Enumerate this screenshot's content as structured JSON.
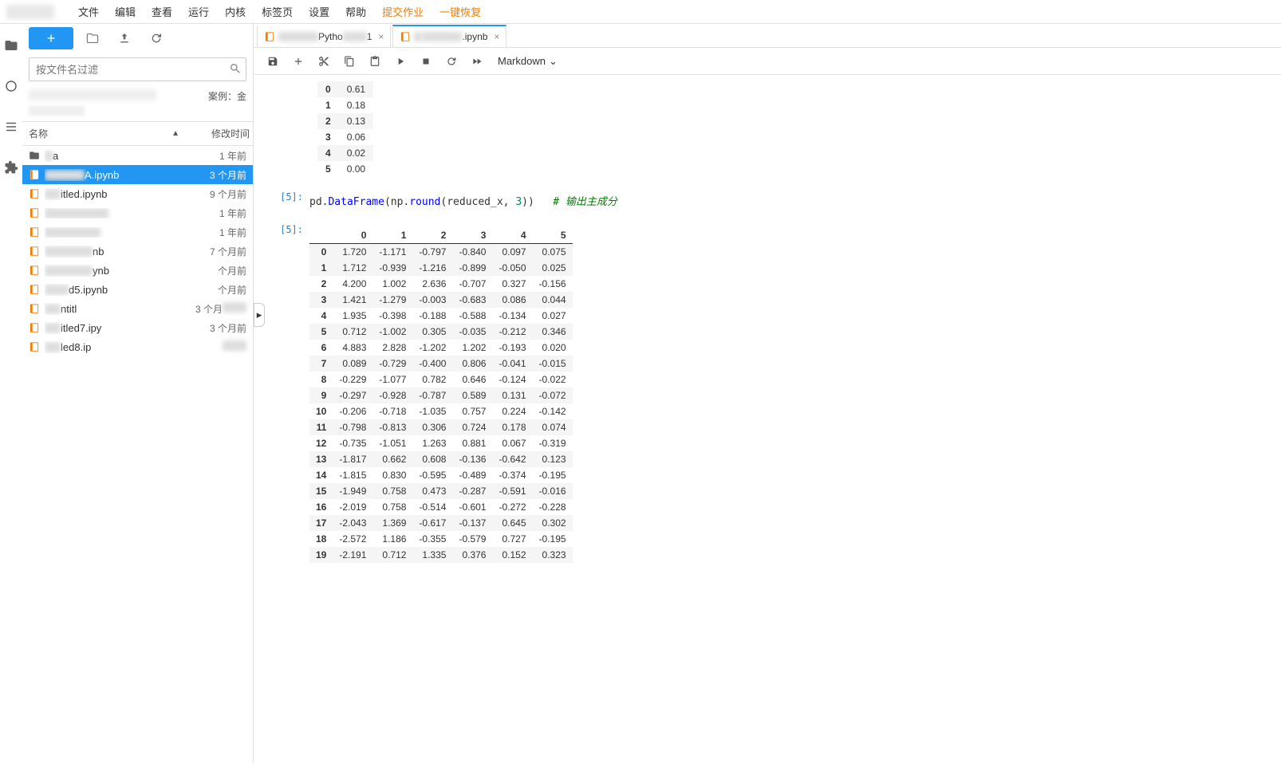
{
  "menu": [
    "文件",
    "编辑",
    "查看",
    "运行",
    "内核",
    "标签页",
    "设置",
    "帮助"
  ],
  "menu_extra": [
    "提交作业",
    "一键恢复"
  ],
  "sidebar": {
    "search_placeholder": "按文件名过滤",
    "crumb_right": "案例：金",
    "header_name": "名称",
    "header_mod": "修改时间",
    "files": [
      {
        "type": "folder",
        "name_visible": "a",
        "blur_w": 10,
        "mod": "1 年前",
        "selected": false
      },
      {
        "type": "nb",
        "name_visible": "A.ipynb",
        "blur_w": 50,
        "mod": "3 个月前",
        "selected": true
      },
      {
        "type": "nb",
        "name_visible": "itled.ipynb",
        "blur_w": 20,
        "mod": "9 个月前",
        "selected": false
      },
      {
        "type": "nb",
        "name_visible": "",
        "blur_w": 80,
        "mod": "1 年前",
        "selected": false
      },
      {
        "type": "nb",
        "name_visible": "",
        "blur_w": 70,
        "mod": "1 年前",
        "selected": false
      },
      {
        "type": "nb",
        "name_visible": "nb",
        "blur_w": 60,
        "mod": "7 个月前",
        "selected": false
      },
      {
        "type": "nb",
        "name_visible": "ynb",
        "blur_w": 60,
        "mod": "个月前",
        "selected": false
      },
      {
        "type": "nb",
        "name_visible": "d5.ipynb",
        "blur_w": 30,
        "mod": "个月前",
        "selected": false
      },
      {
        "type": "nb",
        "name_visible": "ntitl",
        "blur_w": 20,
        "mod": "3 个月",
        "selected": false,
        "mod_blur": true
      },
      {
        "type": "nb",
        "name_visible": "itled7.ipy",
        "blur_w": 20,
        "mod": "3 个月前",
        "selected": false
      },
      {
        "type": "nb",
        "name_visible": "led8.ip",
        "blur_w": 20,
        "mod": "",
        "selected": false,
        "mod_blur": true
      }
    ]
  },
  "tabs": [
    {
      "label_pre": "",
      "label_vis": "Pytho",
      "label_suf": "1",
      "blur1": 50,
      "blur2": 30,
      "active": false
    },
    {
      "label_pre": "p",
      "label_vis": "",
      "label_suf": ".ipynb",
      "blur1": 10,
      "blur2": 50,
      "active": true
    }
  ],
  "nb_toolbar": {
    "celltype": "Markdown"
  },
  "small_table": {
    "rows": [
      [
        "0",
        "0.61"
      ],
      [
        "1",
        "0.18"
      ],
      [
        "2",
        "0.13"
      ],
      [
        "3",
        "0.06"
      ],
      [
        "4",
        "0.02"
      ],
      [
        "5",
        "0.00"
      ]
    ]
  },
  "code_cell": {
    "prompt": "[5]:",
    "out_prompt": "[5]:",
    "code_prefix": "pd.",
    "code_fn": "DataFrame",
    "code_mid": "(np.",
    "code_fn2": "round",
    "code_args": "(reduced_x, ",
    "code_num": "3",
    "code_end": "))",
    "code_comment": "# 输出主成分"
  },
  "chart_data": {
    "type": "table",
    "columns": [
      "0",
      "1",
      "2",
      "3",
      "4",
      "5"
    ],
    "index": [
      "0",
      "1",
      "2",
      "3",
      "4",
      "5",
      "6",
      "7",
      "8",
      "9",
      "10",
      "11",
      "12",
      "13",
      "14",
      "15",
      "16",
      "17",
      "18",
      "19"
    ],
    "data": [
      [
        "1.720",
        "-1.171",
        "-0.797",
        "-0.840",
        "0.097",
        "0.075"
      ],
      [
        "1.712",
        "-0.939",
        "-1.216",
        "-0.899",
        "-0.050",
        "0.025"
      ],
      [
        "4.200",
        "1.002",
        "2.636",
        "-0.707",
        "0.327",
        "-0.156"
      ],
      [
        "1.421",
        "-1.279",
        "-0.003",
        "-0.683",
        "0.086",
        "0.044"
      ],
      [
        "1.935",
        "-0.398",
        "-0.188",
        "-0.588",
        "-0.134",
        "0.027"
      ],
      [
        "0.712",
        "-1.002",
        "0.305",
        "-0.035",
        "-0.212",
        "0.346"
      ],
      [
        "4.883",
        "2.828",
        "-1.202",
        "1.202",
        "-0.193",
        "0.020"
      ],
      [
        "0.089",
        "-0.729",
        "-0.400",
        "0.806",
        "-0.041",
        "-0.015"
      ],
      [
        "-0.229",
        "-1.077",
        "0.782",
        "0.646",
        "-0.124",
        "-0.022"
      ],
      [
        "-0.297",
        "-0.928",
        "-0.787",
        "0.589",
        "0.131",
        "-0.072"
      ],
      [
        "-0.206",
        "-0.718",
        "-1.035",
        "0.757",
        "0.224",
        "-0.142"
      ],
      [
        "-0.798",
        "-0.813",
        "0.306",
        "0.724",
        "0.178",
        "0.074"
      ],
      [
        "-0.735",
        "-1.051",
        "1.263",
        "0.881",
        "0.067",
        "-0.319"
      ],
      [
        "-1.817",
        "0.662",
        "0.608",
        "-0.136",
        "-0.642",
        "0.123"
      ],
      [
        "-1.815",
        "0.830",
        "-0.595",
        "-0.489",
        "-0.374",
        "-0.195"
      ],
      [
        "-1.949",
        "0.758",
        "0.473",
        "-0.287",
        "-0.591",
        "-0.016"
      ],
      [
        "-2.019",
        "0.758",
        "-0.514",
        "-0.601",
        "-0.272",
        "-0.228"
      ],
      [
        "-2.043",
        "1.369",
        "-0.617",
        "-0.137",
        "0.645",
        "0.302"
      ],
      [
        "-2.572",
        "1.186",
        "-0.355",
        "-0.579",
        "0.727",
        "-0.195"
      ],
      [
        "-2.191",
        "0.712",
        "1.335",
        "0.376",
        "0.152",
        "0.323"
      ]
    ]
  }
}
